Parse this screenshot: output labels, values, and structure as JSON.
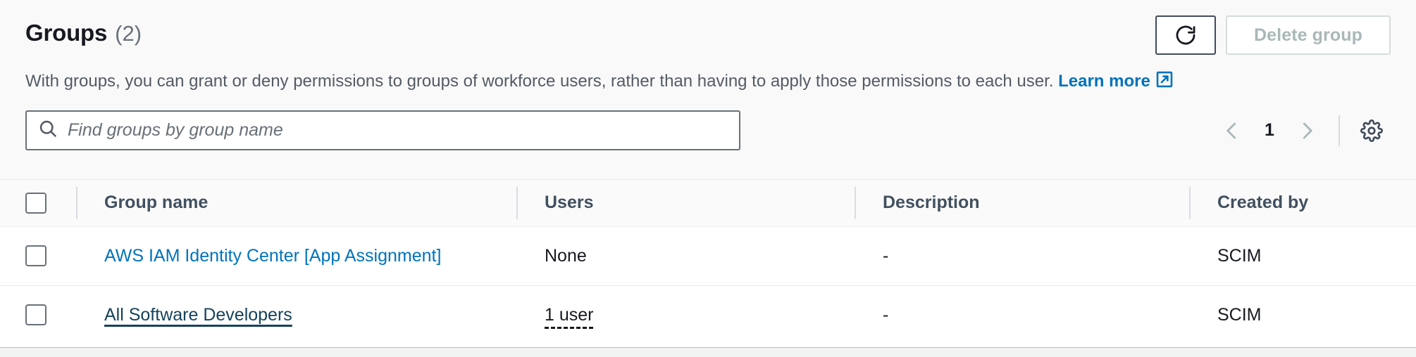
{
  "header": {
    "title": "Groups",
    "count": "(2)",
    "description_prefix": "With groups, you can grant or deny permissions to groups of workforce users, rather than having to apply those permissions to each user.",
    "learn_more_label": "Learn more",
    "refresh_icon": "refresh-icon",
    "delete_button_label": "Delete group"
  },
  "filter": {
    "search_placeholder": "Find groups by group name",
    "search_value": "",
    "search_icon": "search-icon",
    "prev_icon": "chevron-left-icon",
    "next_icon": "chevron-right-icon",
    "page_number": "1",
    "settings_icon": "gear-icon"
  },
  "table": {
    "columns": [
      {
        "key": "select",
        "label": ""
      },
      {
        "key": "group_name",
        "label": "Group name"
      },
      {
        "key": "users",
        "label": "Users"
      },
      {
        "key": "description",
        "label": "Description"
      },
      {
        "key": "created_by",
        "label": "Created by"
      }
    ],
    "rows": [
      {
        "group_name": "AWS IAM Identity Center [App Assignment]",
        "users": "None",
        "users_is_link": false,
        "name_hovered": false,
        "description": "-",
        "created_by": "SCIM"
      },
      {
        "group_name": "All Software Developers",
        "users": "1 user",
        "users_is_link": true,
        "name_hovered": true,
        "description": "-",
        "created_by": "SCIM"
      }
    ]
  },
  "colors": {
    "link": "#0073bb",
    "link_hover": "#16425b",
    "text": "#16191f",
    "muted": "#545b64",
    "disabled": "#aab7b8",
    "border": "#687078",
    "panel_bg": "#ffffff",
    "top_bg": "#f9f9fa"
  }
}
